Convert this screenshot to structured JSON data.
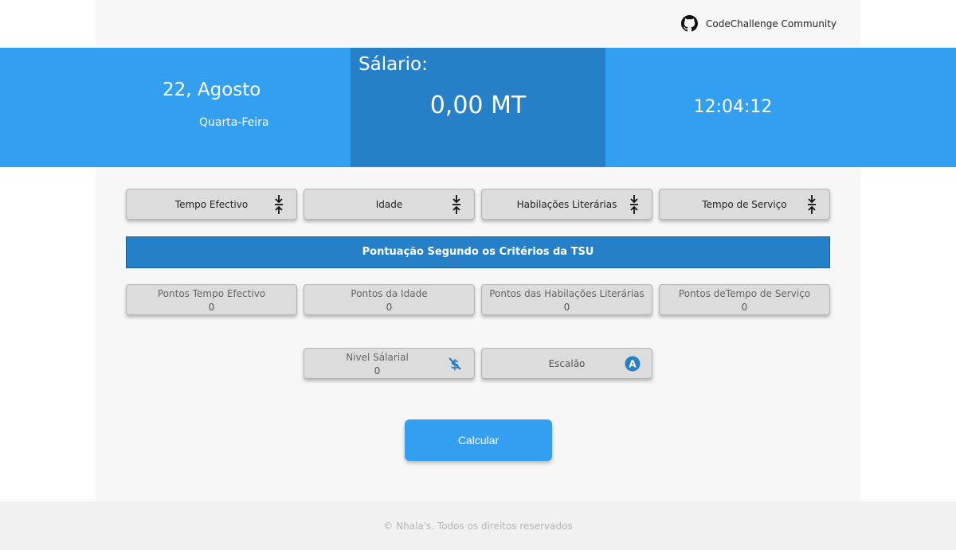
{
  "header": {
    "brand_name": "CodeChallenge Community",
    "brand_icon": "github-icon"
  },
  "banner": {
    "date": "22, Agosto",
    "weekday": "Quarta-Feira",
    "salary_label": "Sálario:",
    "salary_value": "0,00 MT",
    "time": "12:04:12"
  },
  "inputs": [
    {
      "label": "Tempo Efectivo",
      "icon": "compress-arrows-icon"
    },
    {
      "label": "Idade",
      "icon": "compress-arrows-icon"
    },
    {
      "label": "Habilações Literárias",
      "icon": "compress-arrows-icon"
    },
    {
      "label": "Tempo de Serviço",
      "icon": "compress-arrows-icon"
    }
  ],
  "section_title": "Pontuação Segundo os Critérios da TSU",
  "scores": [
    {
      "label": "Pontos Tempo Efectivo",
      "value": "0"
    },
    {
      "label": "Pontos da Idade",
      "value": "0"
    },
    {
      "label": "Pontos das Habilações Literárias",
      "value": "0"
    },
    {
      "label": "Pontos deTempo de Serviço",
      "value": "0"
    }
  ],
  "level": {
    "label": "Nivel Sálarial",
    "value": "0",
    "icon": "no-dollar-icon"
  },
  "escalao": {
    "label": "Escalão",
    "icon": "letter-a-badge-icon",
    "badge_text": "A"
  },
  "calculate_label": "Calcular",
  "footer_text": "© Nhala's. Todos os direitos reservados",
  "colors": {
    "primary": "#339ff0",
    "primary_dark": "#2680c8",
    "card": "#dcdcdc",
    "background": "#f7f7f7"
  }
}
